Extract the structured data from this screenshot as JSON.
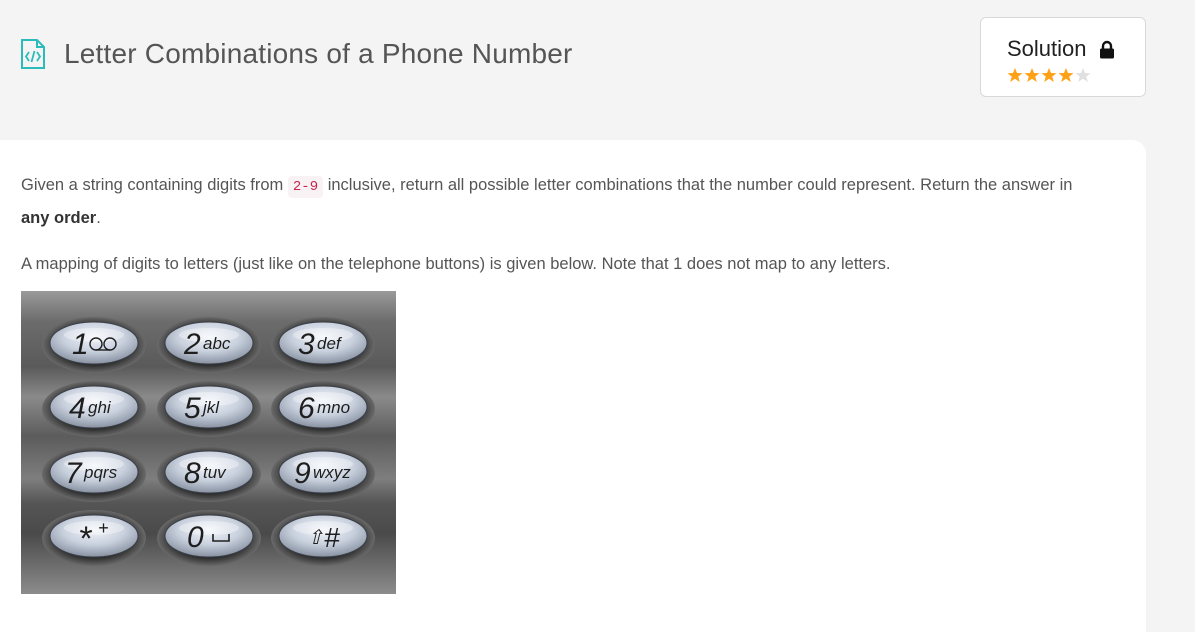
{
  "header": {
    "title": "Letter Combinations of a Phone Number",
    "icon": "code-file-icon"
  },
  "solution": {
    "label": "Solution",
    "icon": "lock-icon",
    "rating": 4,
    "rating_max": 5,
    "star_color": "#ffa116",
    "star_empty_color": "#e0e0e0"
  },
  "description": {
    "p1_before": "Given a string containing digits from ",
    "p1_code": "2-9",
    "p1_middle": " inclusive, return all possible letter combinations that the number could represent. Return the answer in ",
    "p1_bold": "any order",
    "p1_after": ".",
    "p2": "A mapping of digits to letters (just like on the telephone buttons) is given below. Note that 1 does not map to any letters."
  },
  "keypad": {
    "keys": [
      {
        "digit": "1",
        "letters": "",
        "symbol": "voicemail"
      },
      {
        "digit": "2",
        "letters": "abc"
      },
      {
        "digit": "3",
        "letters": "def"
      },
      {
        "digit": "4",
        "letters": "ghi"
      },
      {
        "digit": "5",
        "letters": "jkl"
      },
      {
        "digit": "6",
        "letters": "mno"
      },
      {
        "digit": "7",
        "letters": "pqrs"
      },
      {
        "digit": "8",
        "letters": "tuv"
      },
      {
        "digit": "9",
        "letters": "wxyz"
      },
      {
        "digit": "*",
        "letters": "+"
      },
      {
        "digit": "0",
        "letters": "",
        "symbol": "space"
      },
      {
        "digit": "#",
        "letters": "",
        "symbol": "shift"
      }
    ]
  }
}
